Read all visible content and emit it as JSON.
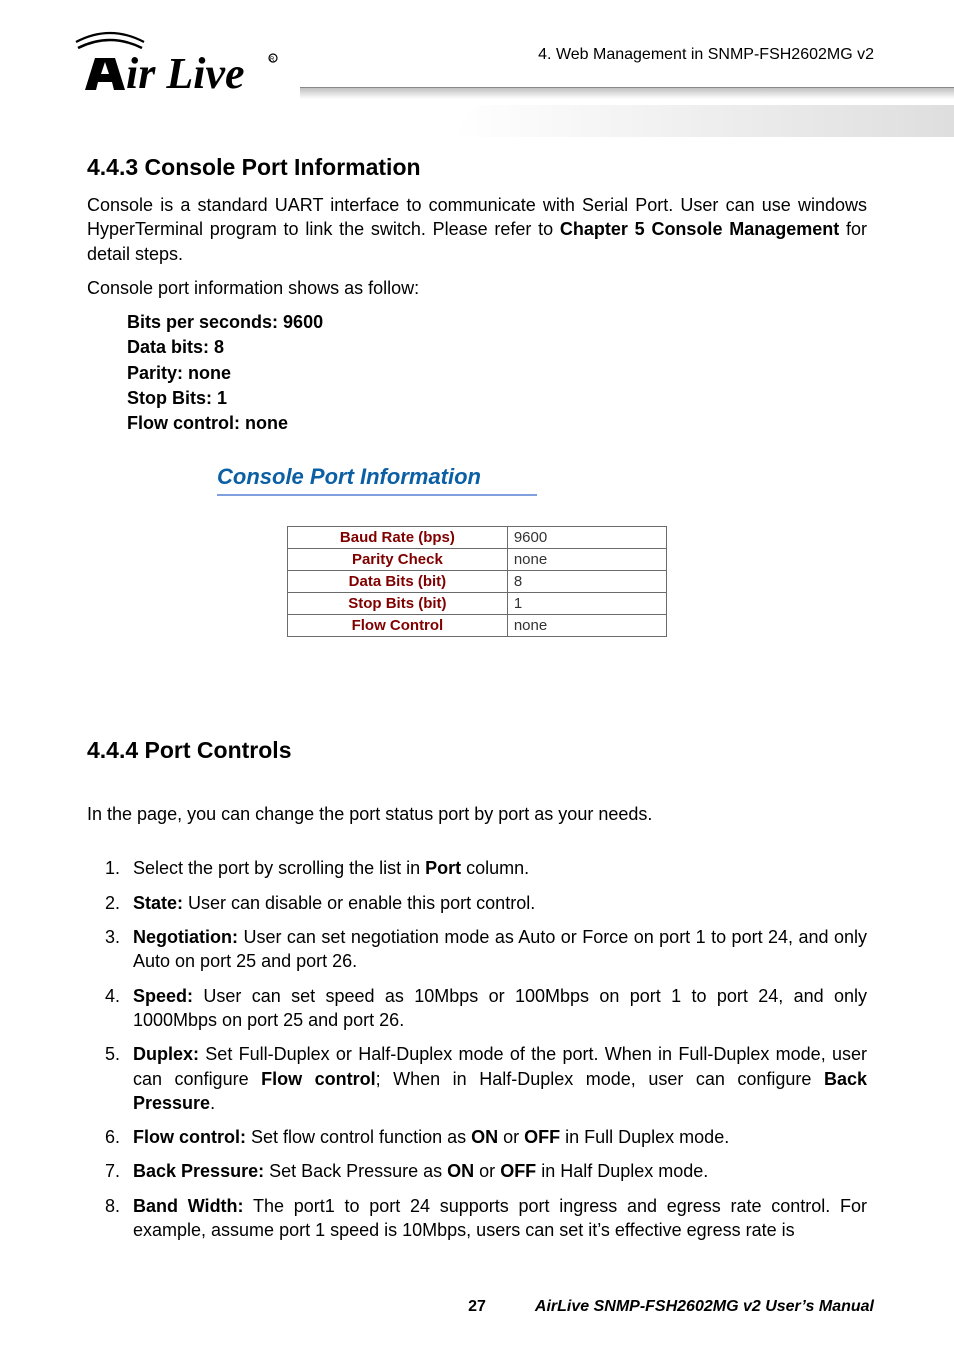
{
  "header": {
    "breadcrumb": "4.  Web  Management  in  SNMP-FSH2602MG  v2",
    "logo_text": "Air Live"
  },
  "section1": {
    "heading": "4.4.3 Console Port Information",
    "para1_pre": "Console is a standard UART interface to communicate with Serial Port. User can use windows HyperTerminal program to link the switch. Please refer to ",
    "para1_bold": "Chapter 5 Console Management",
    "para1_post": " for detail steps.",
    "para2": "Console port information shows as follow:",
    "settings": {
      "s1": "Bits per seconds: 9600",
      "s2": "Data bits: 8",
      "s3": "Parity: none",
      "s4": "Stop Bits: 1",
      "s5": "Flow control: none"
    },
    "figure_heading": "Console Port Information",
    "table": {
      "r1": {
        "label": "Baud Rate (bps)",
        "value": "9600"
      },
      "r2": {
        "label": "Parity Check",
        "value": "none"
      },
      "r3": {
        "label": "Data Bits (bit)",
        "value": "8"
      },
      "r4": {
        "label": "Stop Bits (bit)",
        "value": "1"
      },
      "r5": {
        "label": "Flow Control",
        "value": "none"
      }
    }
  },
  "section2": {
    "heading": "4.4.4 Port Controls",
    "intro": "In the page, you can change the port status port by port as your needs.",
    "items": {
      "i1_pre": "Select the port by scrolling the list in ",
      "i1_b": "Port",
      "i1_post": " column.",
      "i2_b": "State:",
      "i2_post": " User can disable or enable this port control.",
      "i3_b": "Negotiation:",
      "i3_post": " User can set negotiation mode as Auto or Force on port 1 to port 24, and only Auto on port 25 and port 26.",
      "i4_b": "Speed:",
      "i4_post": " User can set speed as 10Mbps or 100Mbps on port 1 to port 24, and only 1000Mbps on port 25 and port 26.",
      "i5_b": "Duplex:",
      "i5_mid1": " Set Full-Duplex or Half-Duplex mode of the port. When in Full-Duplex mode, user can configure ",
      "i5_b2": "Flow control",
      "i5_mid2": "; When in Half-Duplex mode, user can configure ",
      "i5_b3": "Back Pressure",
      "i5_post": ".",
      "i6_b": "Flow control:",
      "i6_mid1": " Set flow control function as ",
      "i6_b2": "ON",
      "i6_mid2": " or ",
      "i6_b3": "OFF",
      "i6_post": " in Full Duplex mode.",
      "i7_b": "Back Pressure:",
      "i7_mid1": " Set Back Pressure as ",
      "i7_b2": "ON",
      "i7_mid2": " or ",
      "i7_b3": "OFF",
      "i7_post": " in Half Duplex mode.",
      "i8_b": "Band Width:",
      "i8_post": " The port1 to port 24 supports port ingress and egress rate control. For example, assume port 1 speed is 10Mbps, users can set it’s effective egress rate is"
    }
  },
  "footer": {
    "page_number": "27",
    "title": "AirLive  SNMP-FSH2602MG  v2  User’s  Manual"
  }
}
